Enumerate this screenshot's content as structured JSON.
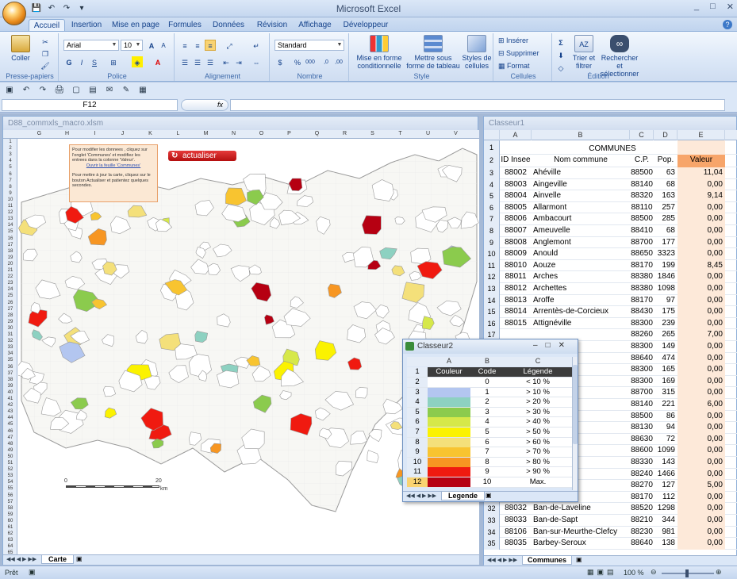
{
  "app": {
    "title": "Microsoft Excel",
    "window_controls": [
      "_",
      "□",
      "✕"
    ]
  },
  "qat": [
    "💾",
    "↶",
    "↷",
    "▾"
  ],
  "tabs": [
    "Accueil",
    "Insertion",
    "Mise en page",
    "Formules",
    "Données",
    "Révision",
    "Affichage",
    "Développeur"
  ],
  "ribbon": {
    "clipboard": {
      "label": "Presse-papiers",
      "paste": "Coller"
    },
    "font": {
      "label": "Police",
      "name": "Arial",
      "size": "10"
    },
    "alignment": {
      "label": "Alignement"
    },
    "number": {
      "label": "Nombre",
      "format": "Standard"
    },
    "style": {
      "label": "Style",
      "cond": "Mise en forme conditionnelle",
      "table": "Mettre sous forme de tableau",
      "cell": "Styles de cellules"
    },
    "cells": {
      "label": "Cellules",
      "insert": "Insérer",
      "delete": "Supprimer",
      "format": "Format"
    },
    "edit": {
      "label": "Édition",
      "sort": "Trier et filtrer",
      "find": "Rechercher et sélectionner"
    }
  },
  "formula_bar": {
    "cell": "F12",
    "fx": "fx",
    "value": ""
  },
  "left_workbook": {
    "title": "D88_commxls_macro.xlsm",
    "columns": [
      "G",
      "H",
      "I",
      "J",
      "K",
      "L",
      "M",
      "N",
      "O",
      "P",
      "Q",
      "R",
      "S",
      "T",
      "U",
      "V"
    ],
    "rows": [
      "1",
      "2",
      "3",
      "4",
      "5",
      "6",
      "7",
      "8",
      "9",
      "10",
      "11",
      "12",
      "13",
      "14",
      "15",
      "16",
      "17",
      "18",
      "19",
      "20",
      "21",
      "22",
      "23",
      "24",
      "25",
      "26",
      "27",
      "28",
      "29",
      "30",
      "31",
      "32",
      "33",
      "34",
      "35",
      "36",
      "37",
      "38",
      "39",
      "40",
      "41",
      "42",
      "43",
      "44",
      "45",
      "46",
      "47",
      "48",
      "49",
      "50",
      "51",
      "52",
      "53",
      "54",
      "55",
      "56",
      "57",
      "58",
      "59",
      "60",
      "61",
      "62",
      "63",
      "64",
      "65"
    ],
    "info_text": "Pour modifier les donnees , cliquez sur l'onglet 'Communes' et modifiez les entrees dans la colonne 'Valeur'.",
    "info_link": "Ouvrir la feuille 'Communes'",
    "info_text2": "Pour mettre à jour la carte, cliquez sur le bouton Actualiser et patientez quelques secondes.",
    "refresh_button": "actualiser",
    "scale": {
      "zero": "0",
      "twenty": "20",
      "unit": "km"
    },
    "sheet_tab": "Carte"
  },
  "right_workbook": {
    "title": "Classeur1",
    "columns": [
      "A",
      "B",
      "C",
      "D",
      "E"
    ],
    "header_title": "COMMUNES",
    "headers": [
      "ID Insee",
      "Nom commune",
      "C.P.",
      "Pop.",
      "Valeur"
    ],
    "rows": [
      [
        "3",
        "88002",
        "Ahéville",
        "88500",
        "63",
        "11,04"
      ],
      [
        "4",
        "88003",
        "Aingeville",
        "88140",
        "68",
        "0,00"
      ],
      [
        "5",
        "88004",
        "Ainvelle",
        "88320",
        "163",
        "9,14"
      ],
      [
        "6",
        "88005",
        "Allarmont",
        "88110",
        "257",
        "0,00"
      ],
      [
        "7",
        "88006",
        "Ambacourt",
        "88500",
        "285",
        "0,00"
      ],
      [
        "8",
        "88007",
        "Ameuvelle",
        "88410",
        "68",
        "0,00"
      ],
      [
        "9",
        "88008",
        "Anglemont",
        "88700",
        "177",
        "0,00"
      ],
      [
        "10",
        "88009",
        "Anould",
        "88650",
        "3323",
        "0,00"
      ],
      [
        "11",
        "88010",
        "Aouze",
        "88170",
        "199",
        "8,45"
      ],
      [
        "12",
        "88011",
        "Arches",
        "88380",
        "1846",
        "0,00"
      ],
      [
        "13",
        "88012",
        "Archettes",
        "88380",
        "1098",
        "0,00"
      ],
      [
        "14",
        "88013",
        "Aroffe",
        "88170",
        "97",
        "0,00"
      ],
      [
        "15",
        "88014",
        "Arrentès-de-Corcieux",
        "88430",
        "175",
        "0,00"
      ],
      [
        "16",
        "88015",
        "Attignéville",
        "88300",
        "239",
        "0,00"
      ],
      [
        "17",
        "",
        "",
        "88260",
        "265",
        "7,00"
      ],
      [
        "18",
        "",
        "",
        "88300",
        "149",
        "0,00"
      ],
      [
        "19",
        "",
        "",
        "88640",
        "474",
        "0,00"
      ],
      [
        "20",
        "",
        "our",
        "88300",
        "165",
        "0,00"
      ],
      [
        "21",
        "",
        "",
        "88300",
        "169",
        "0,00"
      ],
      [
        "22",
        "",
        "",
        "88700",
        "315",
        "0,00"
      ],
      [
        "23",
        "",
        "s",
        "88140",
        "221",
        "6,00"
      ],
      [
        "24",
        "",
        "",
        "88500",
        "86",
        "0,00"
      ],
      [
        "25",
        "",
        "",
        "88130",
        "94",
        "0,00"
      ],
      [
        "26",
        "",
        "",
        "88630",
        "72",
        "0,00"
      ],
      [
        "27",
        "",
        "",
        "88600",
        "1099",
        "0,00"
      ],
      [
        "28",
        "",
        "x-Bois",
        "88330",
        "143",
        "0,00"
      ],
      [
        "29",
        "",
        "ns",
        "88240",
        "1466",
        "0,00"
      ],
      [
        "30",
        "",
        "-Saules",
        "88270",
        "127",
        "5,00"
      ],
      [
        "31",
        "88031",
        "Bainville",
        "88170",
        "112",
        "0,00"
      ],
      [
        "32",
        "88032",
        "Ban-de-Laveline",
        "88520",
        "1298",
        "0,00"
      ],
      [
        "33",
        "88033",
        "Ban-de-Sapt",
        "88210",
        "344",
        "0,00"
      ],
      [
        "34",
        "88106",
        "Ban-sur-Meurthe-Clefcy",
        "88230",
        "981",
        "0,00"
      ],
      [
        "35",
        "88035",
        "Barbey-Seroux",
        "88640",
        "138",
        "0,00"
      ]
    ],
    "sheet_tab": "Communes"
  },
  "legend_workbook": {
    "title": "Classeur2",
    "columns": [
      "A",
      "B",
      "C"
    ],
    "headers": [
      "Couleur",
      "Code",
      "Légende"
    ],
    "rows": [
      {
        "n": "2",
        "color": "#ffffff",
        "code": "0",
        "label": "< 10 %"
      },
      {
        "n": "3",
        "color": "#b3c6f0",
        "code": "1",
        "label": "> 10 %"
      },
      {
        "n": "4",
        "color": "#8dd1c1",
        "code": "2",
        "label": "> 20 %"
      },
      {
        "n": "5",
        "color": "#8bcb4d",
        "code": "3",
        "label": "> 30 %"
      },
      {
        "n": "6",
        "color": "#d6e84a",
        "code": "4",
        "label": "> 40 %"
      },
      {
        "n": "7",
        "color": "#fbf200",
        "code": "5",
        "label": "> 50 %"
      },
      {
        "n": "8",
        "color": "#f4e07a",
        "code": "6",
        "label": "> 60 %"
      },
      {
        "n": "9",
        "color": "#f8c430",
        "code": "7",
        "label": "> 70 %"
      },
      {
        "n": "10",
        "color": "#f79622",
        "code": "8",
        "label": "> 80 %"
      },
      {
        "n": "11",
        "color": "#f01a10",
        "code": "9",
        "label": "> 90 %"
      },
      {
        "n": "12",
        "color": "#b60012",
        "code": "10",
        "label": "Max."
      }
    ],
    "sheet_tab": "Legende"
  },
  "status": {
    "ready": "Prêt",
    "zoom": "100 %"
  }
}
